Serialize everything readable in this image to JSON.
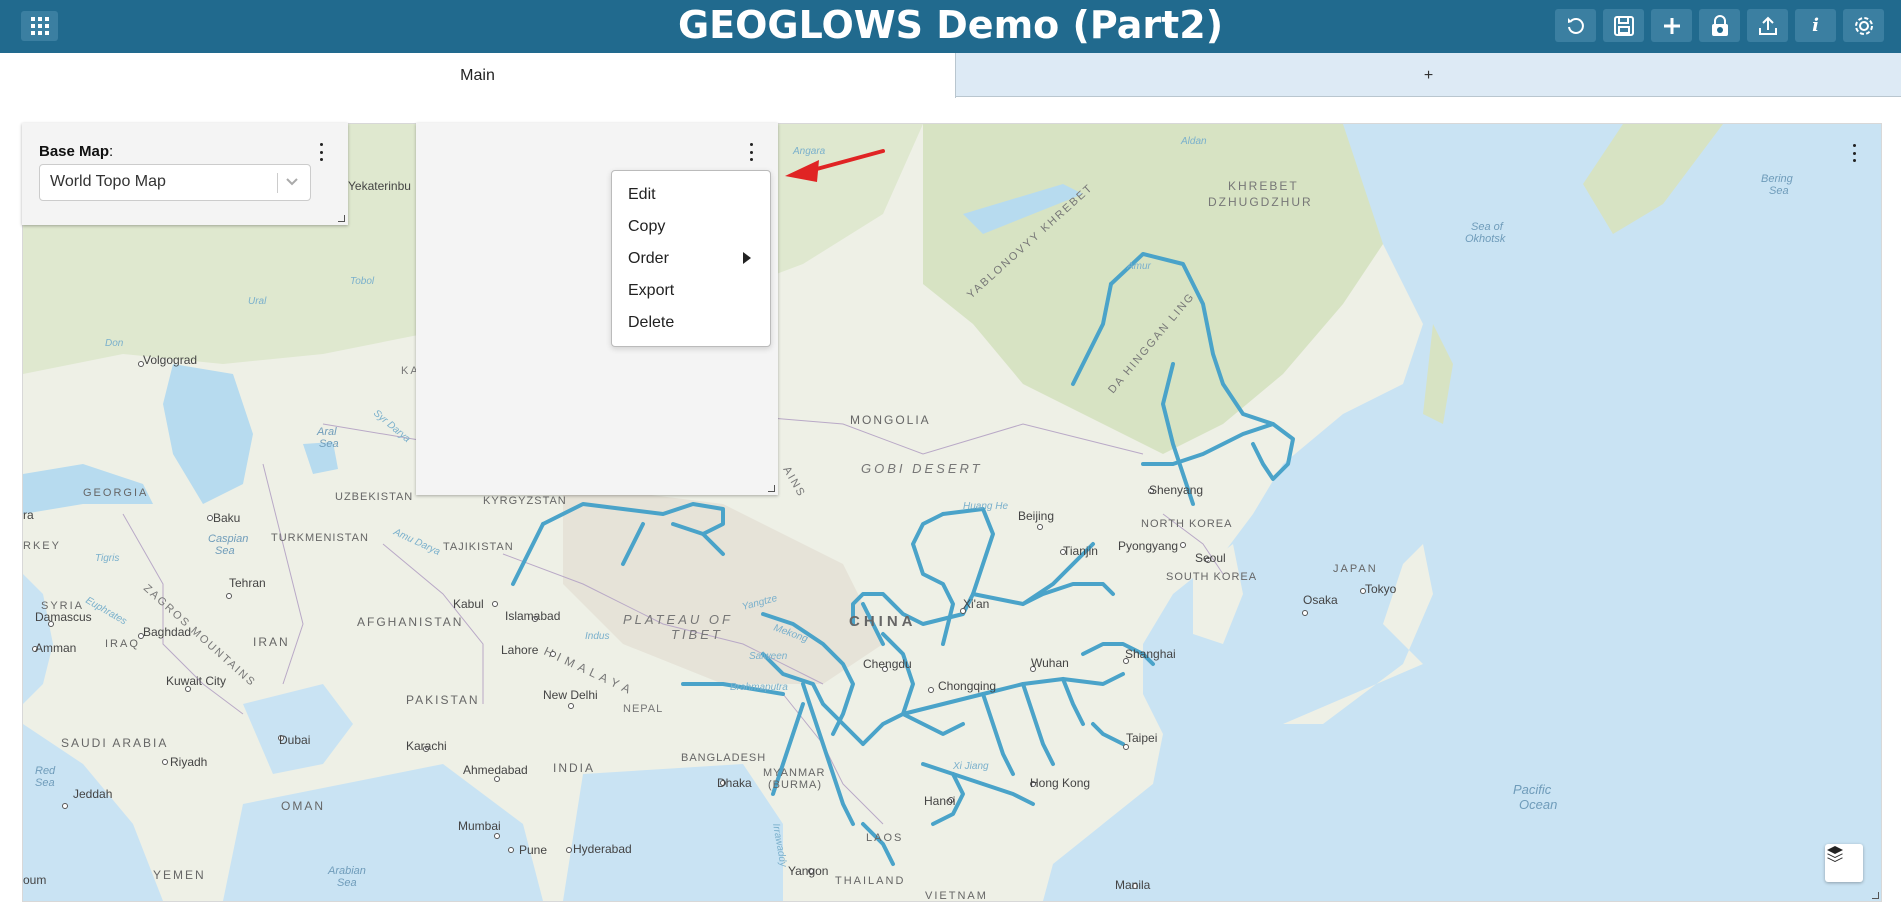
{
  "header": {
    "title": "GEOGLOWS Demo (Part2)",
    "icons": [
      "apps-grid-icon",
      "refresh-icon",
      "save-icon",
      "add-icon",
      "lock-icon",
      "share-icon",
      "info-icon",
      "settings-icon"
    ],
    "accent": "#216a8e"
  },
  "tabs": [
    {
      "label": "Main"
    },
    {
      "label": "+"
    }
  ],
  "basemap_widget": {
    "label": "Base Map",
    "colon": ":",
    "selected": "World Topo Map"
  },
  "context_menu": {
    "items": [
      "Edit",
      "Copy",
      "Order",
      "Export",
      "Delete"
    ]
  },
  "map": {
    "labels": {
      "mongolia": "MONGOLIA",
      "gobi": "GOBI DESERT",
      "china": "CHINA",
      "plateau": "PLATEAU OF",
      "tibet": "TIBET",
      "himalaya": "H I M A L A Y A",
      "nepal": "NEPAL",
      "india": "INDIA",
      "pakistan": "PAKISTAN",
      "afghanistan": "AFGHANISTAN",
      "iran": "IRAN",
      "iraq": "IRAQ",
      "syria": "SYRIA",
      "saudi": "SAUDI ARABIA",
      "oman": "OMAN",
      "yemen": "YEMEN",
      "georgia": "GEORGIA",
      "uzbekistan": "UZBEKISTAN",
      "kyrgyzstan": "KYRGYZSTAN",
      "tajikistan": "TAJIKISTAN",
      "turkmenistan": "TURKMENISTAN",
      "rkey": "RKEY",
      "bangladesh": "BANGLADESH",
      "myanmar": "MYANMAR",
      "burma": "(BURMA)",
      "laos": "LAOS",
      "thailand": "THAILAND",
      "vietnam": "VIETNAM",
      "north_korea": "NORTH KOREA",
      "south_korea": "SOUTH KOREA",
      "japan": "JAPAN",
      "khrebet1": "KHREBET",
      "khrebet2": "DZHUGDZHUR",
      "yablonovyy": "YABLONOVYY KHREBET",
      "dahinggan": "DA HINGGAN LING",
      "zagros": "ZAGROS MOUNTAINS",
      "ka": "KA",
      "ains": "AINS",
      "bering": "Bering",
      "bering2": "Sea",
      "okhotsk": "Sea of",
      "okhotsk2": "Okhotsk",
      "caspian": "Caspian",
      "caspian2": "Sea",
      "aral": "Aral",
      "aral2": "Sea",
      "red": "Red",
      "red2": "Sea",
      "arabian": "Arabian",
      "arabian2": "Sea",
      "pacific": "Pacific",
      "pacific2": "Ocean",
      "ural": "Ural",
      "don": "Don",
      "amur": "Amur",
      "aldan": "Aldan",
      "angara": "Angara",
      "tobol": "Tobol",
      "syr": "Syr Darya",
      "amu": "Amu Darya",
      "tigris": "Tigris",
      "euphrates": "Euphrates",
      "indus": "Indus",
      "yangtze": "Yangtze",
      "mekong": "Mekong",
      "salween": "Salween",
      "brahmaputra": "Brahmaputra",
      "irrawaddy": "Irrawaddy",
      "huang": "Huang He",
      "xi": "Xi Jiang"
    },
    "cities": {
      "volgograd": "Volgograd",
      "yekaterinburg": "Yekaterinbu",
      "baku": "Baku",
      "tehran": "Tehran",
      "damascus": "Damascus",
      "baghdad": "Baghdad",
      "amman": "Amman",
      "kuwait": "Kuwait City",
      "riyadh": "Riyadh",
      "jeddah": "Jeddah",
      "dubai": "Dubai",
      "karachi": "Karachi",
      "kabul": "Kabul",
      "islamabad": "Islamabad",
      "lahore": "Lahore",
      "newdelhi": "New Delhi",
      "ahmedabad": "Ahmedabad",
      "mumbai": "Mumbai",
      "pune": "Pune",
      "hyderabad": "Hyderabad",
      "dhaka": "Dhaka",
      "chengdu": "Chengdu",
      "chongqing": "Chongqing",
      "wuhan": "Wuhan",
      "shanghai": "Shanghai",
      "xian": "Xi'an",
      "beijing": "Beijing",
      "tianjin": "Tianjin",
      "shenyang": "Shenyang",
      "pyongyang": "Pyongyang",
      "seoul": "Seoul",
      "osaka": "Osaka",
      "tokyo": "Tokyo",
      "taipei": "Taipei",
      "hongkong": "Hong Kong",
      "hanoi": "Hanoi",
      "yangon": "Yangon",
      "manila": "Manila",
      "oum": "oum",
      "ra": "ra"
    }
  }
}
